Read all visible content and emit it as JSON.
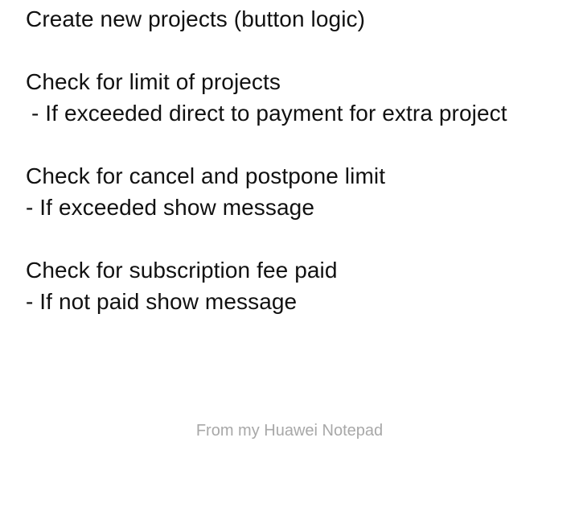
{
  "note": {
    "lines": [
      "Create new projects (button logic)",
      "",
      "Check for limit of projects",
      " - If exceeded direct to payment for extra project",
      "",
      "Check for cancel and postpone limit",
      "- If exceeded show message",
      "",
      "Check for subscription fee paid",
      "- If not paid show message"
    ]
  },
  "footer": {
    "text": "From my Huawei Notepad"
  }
}
